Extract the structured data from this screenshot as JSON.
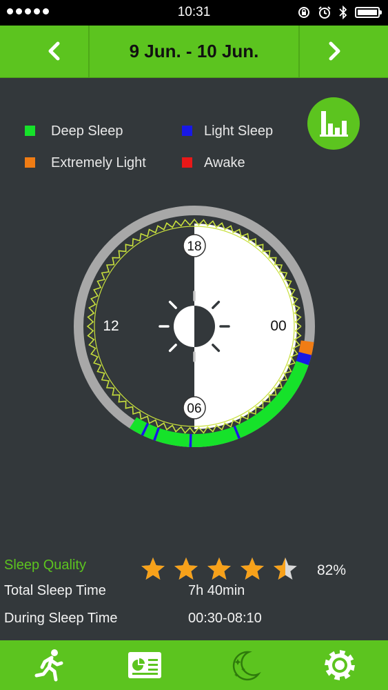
{
  "status_bar": {
    "time": "10:31"
  },
  "header": {
    "date_range": "9 Jun. - 10 Jun.",
    "prev_icon": "chevron-left-icon",
    "next_icon": "chevron-right-icon"
  },
  "legend": [
    {
      "label": "Deep Sleep",
      "color": "#16e22a"
    },
    {
      "label": "Light Sleep",
      "color": "#1818e6"
    },
    {
      "label": "Extremely Light",
      "color": "#f07c14"
    },
    {
      "label": "Awake",
      "color": "#e81818"
    }
  ],
  "dial": {
    "labels": {
      "top": "18",
      "left": "12",
      "right": "00",
      "bottom": "06"
    },
    "center_icon": "sun-icon",
    "sleep_segments": [
      {
        "stage": "Extremely Light",
        "start": "00:30",
        "end": "00:55"
      },
      {
        "stage": "Light Sleep",
        "start": "00:55",
        "end": "01:15"
      },
      {
        "stage": "Deep Sleep",
        "start": "01:15",
        "end": "04:30"
      },
      {
        "stage": "Light Sleep",
        "start": "04:30",
        "end": "04:35"
      },
      {
        "stage": "Deep Sleep",
        "start": "04:35",
        "end": "06:05"
      },
      {
        "stage": "Light Sleep",
        "start": "06:05",
        "end": "06:10"
      },
      {
        "stage": "Deep Sleep",
        "start": "06:10",
        "end": "07:15"
      },
      {
        "stage": "Light Sleep",
        "start": "07:15",
        "end": "07:20"
      },
      {
        "stage": "Deep Sleep",
        "start": "07:20",
        "end": "07:40"
      },
      {
        "stage": "Light Sleep",
        "start": "07:40",
        "end": "07:45"
      },
      {
        "stage": "Deep Sleep",
        "start": "07:45",
        "end": "08:10"
      }
    ]
  },
  "summary": {
    "quality_label": "Sleep Quality",
    "rating": 4.5,
    "max_rating": 5,
    "quality_percent": "82%",
    "total_label": "Total Sleep Time",
    "total_value": "7h 40min",
    "during_label": "During Sleep Time",
    "during_value": "00:30-08:10"
  },
  "tabs": [
    {
      "icon": "running-icon"
    },
    {
      "icon": "report-icon"
    },
    {
      "icon": "moon-stars-icon"
    },
    {
      "icon": "gear-icon"
    }
  ],
  "colors": {
    "accent": "#5cc41f",
    "background": "#33383b"
  }
}
